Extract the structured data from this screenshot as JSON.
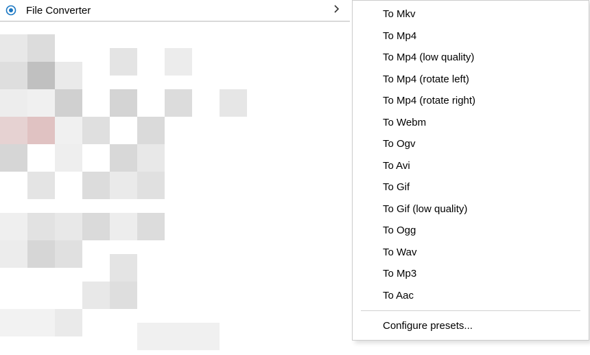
{
  "context_menu": {
    "app_item_label": "File Converter"
  },
  "submenu": {
    "items": [
      "To Mkv",
      "To Mp4",
      "To Mp4 (low quality)",
      "To Mp4 (rotate left)",
      "To Mp4 (rotate right)",
      "To Webm",
      "To Ogv",
      "To Avi",
      "To Gif",
      "To Gif (low quality)",
      "To Ogg",
      "To Wav",
      "To Mp3",
      "To Aac"
    ],
    "configure_label": "Configure presets..."
  }
}
